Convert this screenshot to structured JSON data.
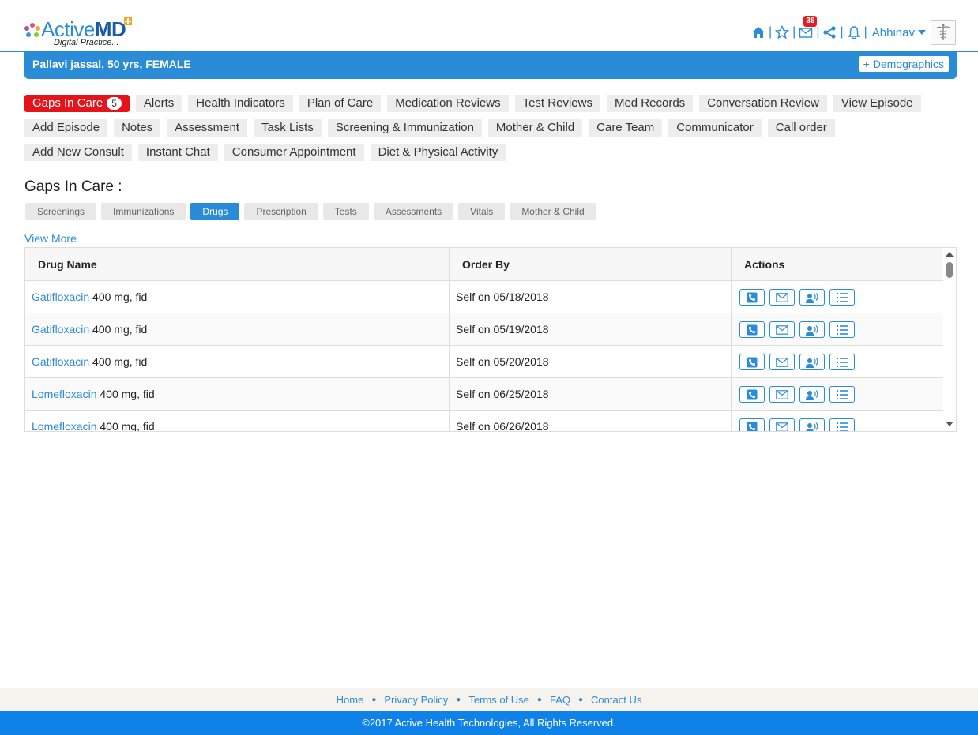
{
  "header": {
    "logo_main_a": "Active",
    "logo_main_b": "MD",
    "logo_sub": "Digital Practice...",
    "mail_count": "36",
    "user_name": "Abhinav",
    "icons": [
      "home-icon",
      "star-icon",
      "mail-icon",
      "share-icon",
      "bell-icon"
    ]
  },
  "patient": {
    "name": "Pallavi jassal, 50 yrs, FEMALE",
    "demographics_label": "+ Demographics"
  },
  "tabs": {
    "row1": [
      {
        "label": "Gaps In Care",
        "count": "5",
        "active": true
      },
      {
        "label": "Alerts"
      },
      {
        "label": "Health Indicators"
      },
      {
        "label": "Plan of Care"
      },
      {
        "label": "Medication Reviews"
      },
      {
        "label": "Test Reviews"
      },
      {
        "label": "Med Records"
      },
      {
        "label": "Conversation Review"
      },
      {
        "label": "View Episode"
      }
    ],
    "row2": [
      {
        "label": "Add Episode"
      },
      {
        "label": "Notes"
      },
      {
        "label": "Assessment"
      },
      {
        "label": "Task Lists"
      },
      {
        "label": "Screening & Immunization"
      },
      {
        "label": "Mother & Child"
      },
      {
        "label": "Care Team"
      },
      {
        "label": "Communicator"
      },
      {
        "label": "Call order"
      }
    ],
    "row3": [
      {
        "label": "Add New Consult"
      },
      {
        "label": "Instant Chat"
      },
      {
        "label": "Consumer Appointment"
      },
      {
        "label": "Diet & Physical Activity"
      }
    ]
  },
  "gaps": {
    "title": "Gaps In Care :",
    "subtabs": [
      "Screenings",
      "Immunizations",
      "Drugs",
      "Prescription",
      "Tests",
      "Assessments",
      "Vitals",
      "Mother & Child"
    ],
    "active_subtab": "Drugs",
    "view_more": "View More"
  },
  "table": {
    "headers": [
      "Drug Name",
      "Order By",
      "Actions"
    ],
    "rows": [
      {
        "drug": "Gatifloxacin",
        "dose": " 400 mg, fid",
        "order": "Self on 05/18/2018"
      },
      {
        "drug": "Gatifloxacin",
        "dose": " 400 mg, fid",
        "order": "Self on 05/19/2018"
      },
      {
        "drug": "Gatifloxacin",
        "dose": " 400 mg, fid",
        "order": "Self on 05/20/2018"
      },
      {
        "drug": "Lomefloxacin",
        "dose": " 400 mg, fid",
        "order": "Self on 06/25/2018"
      },
      {
        "drug": "Lomefloxacin",
        "dose": " 400 mg, fid",
        "order": "Self on 06/26/2018"
      }
    ],
    "action_icons": [
      "phone-icon",
      "email-icon",
      "voice-icon",
      "list-icon"
    ]
  },
  "footer": {
    "links": [
      "Home",
      "Privacy Policy",
      "Terms of Use",
      "FAQ",
      "Contact Us"
    ],
    "copyright": "©2017 Active Health Technologies, All Rights Reserved."
  },
  "colors": {
    "primary": "#2a8bd6",
    "active_tab": "#e5141a",
    "footer_bar": "#0e82e6"
  }
}
